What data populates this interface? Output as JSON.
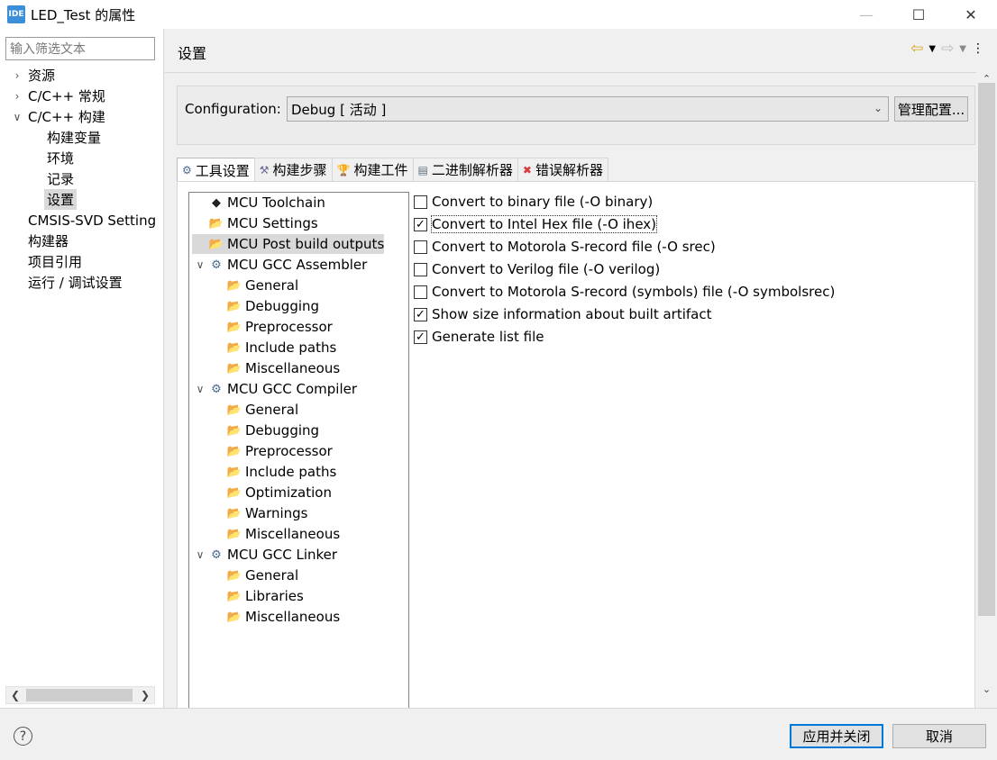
{
  "window": {
    "app_icon": "IDE",
    "title": "LED_Test 的属性",
    "buttons": [
      "minimize-icon",
      "maximize-icon",
      "close-icon"
    ]
  },
  "left_panel": {
    "filter_placeholder": "输入筛选文本",
    "tree": [
      {
        "label": "资源",
        "expander": "collapsed"
      },
      {
        "label": "C/C++ 常规",
        "expander": "collapsed"
      },
      {
        "label": "C/C++ 构建",
        "expander": "expanded"
      },
      {
        "label": "构建变量",
        "level": 1
      },
      {
        "label": "环境",
        "level": 1
      },
      {
        "label": "记录",
        "level": 1
      },
      {
        "label": "设置",
        "level": 1,
        "selected": true
      },
      {
        "label": "CMSIS-SVD Setting"
      },
      {
        "label": "构建器"
      },
      {
        "label": "项目引用"
      },
      {
        "label": "运行 / 调试设置"
      }
    ]
  },
  "header": {
    "page_title": "设置",
    "nav_icons": [
      "back-arrow-icon",
      "dropdown-icon",
      "forward-arrow-icon",
      "dropdown-icon",
      "more-icon"
    ]
  },
  "configuration": {
    "label": "Configuration:",
    "value": "Debug  [ 活动 ]",
    "manage_button": "管理配置..."
  },
  "tabs": [
    {
      "label": "工具设置",
      "icon": "tool-settings-icon",
      "active": true
    },
    {
      "label": "构建步骤",
      "icon": "build-steps-icon"
    },
    {
      "label": "构建工件",
      "icon": "build-artifact-icon"
    },
    {
      "label": "二进制解析器",
      "icon": "binary-parser-icon"
    },
    {
      "label": "错误解析器",
      "icon": "error-parser-icon"
    }
  ],
  "tool_tree": [
    {
      "label": "MCU Toolchain",
      "icon": "chip-icon",
      "level": 0
    },
    {
      "label": "MCU Settings",
      "icon": "folder-icon",
      "level": 0
    },
    {
      "label": "MCU Post build outputs",
      "icon": "folder-icon",
      "level": 0,
      "selected": true
    },
    {
      "label": "MCU GCC Assembler",
      "icon": "gear-icon",
      "level": 0,
      "expander": "expanded"
    },
    {
      "label": "General",
      "icon": "folder-icon",
      "level": 1
    },
    {
      "label": "Debugging",
      "icon": "folder-icon",
      "level": 1
    },
    {
      "label": "Preprocessor",
      "icon": "folder-icon",
      "level": 1
    },
    {
      "label": "Include paths",
      "icon": "folder-icon",
      "level": 1
    },
    {
      "label": "Miscellaneous",
      "icon": "folder-icon",
      "level": 1
    },
    {
      "label": "MCU GCC Compiler",
      "icon": "gear-icon",
      "level": 0,
      "expander": "expanded"
    },
    {
      "label": "General",
      "icon": "folder-icon",
      "level": 1
    },
    {
      "label": "Debugging",
      "icon": "folder-icon",
      "level": 1
    },
    {
      "label": "Preprocessor",
      "icon": "folder-icon",
      "level": 1
    },
    {
      "label": "Include paths",
      "icon": "folder-icon",
      "level": 1
    },
    {
      "label": "Optimization",
      "icon": "folder-icon",
      "level": 1
    },
    {
      "label": "Warnings",
      "icon": "folder-icon",
      "level": 1
    },
    {
      "label": "Miscellaneous",
      "icon": "folder-icon",
      "level": 1
    },
    {
      "label": "MCU GCC Linker",
      "icon": "gear-icon",
      "level": 0,
      "expander": "expanded"
    },
    {
      "label": "General",
      "icon": "folder-icon",
      "level": 1
    },
    {
      "label": "Libraries",
      "icon": "folder-icon",
      "level": 1
    },
    {
      "label": "Miscellaneous",
      "icon": "folder-icon",
      "level": 1
    }
  ],
  "options": [
    {
      "label": "Convert to binary file (-O binary)",
      "checked": false
    },
    {
      "label": "Convert to Intel Hex file (-O ihex)",
      "checked": true,
      "focused": true
    },
    {
      "label": "Convert to Motorola S-record file (-O srec)",
      "checked": false
    },
    {
      "label": "Convert to Verilog file (-O verilog)",
      "checked": false
    },
    {
      "label": "Convert to Motorola S-record (symbols) file (-O symbolsrec)",
      "checked": false
    },
    {
      "label": "Show size information about built artifact",
      "checked": true
    },
    {
      "label": "Generate list file",
      "checked": true
    }
  ],
  "footer": {
    "help_icon": "help-icon",
    "apply_close": "应用并关闭",
    "cancel": "取消"
  },
  "colors": {
    "accent": "#0078d7",
    "folder": "#d49a23",
    "selection": "#d9d9d9"
  }
}
